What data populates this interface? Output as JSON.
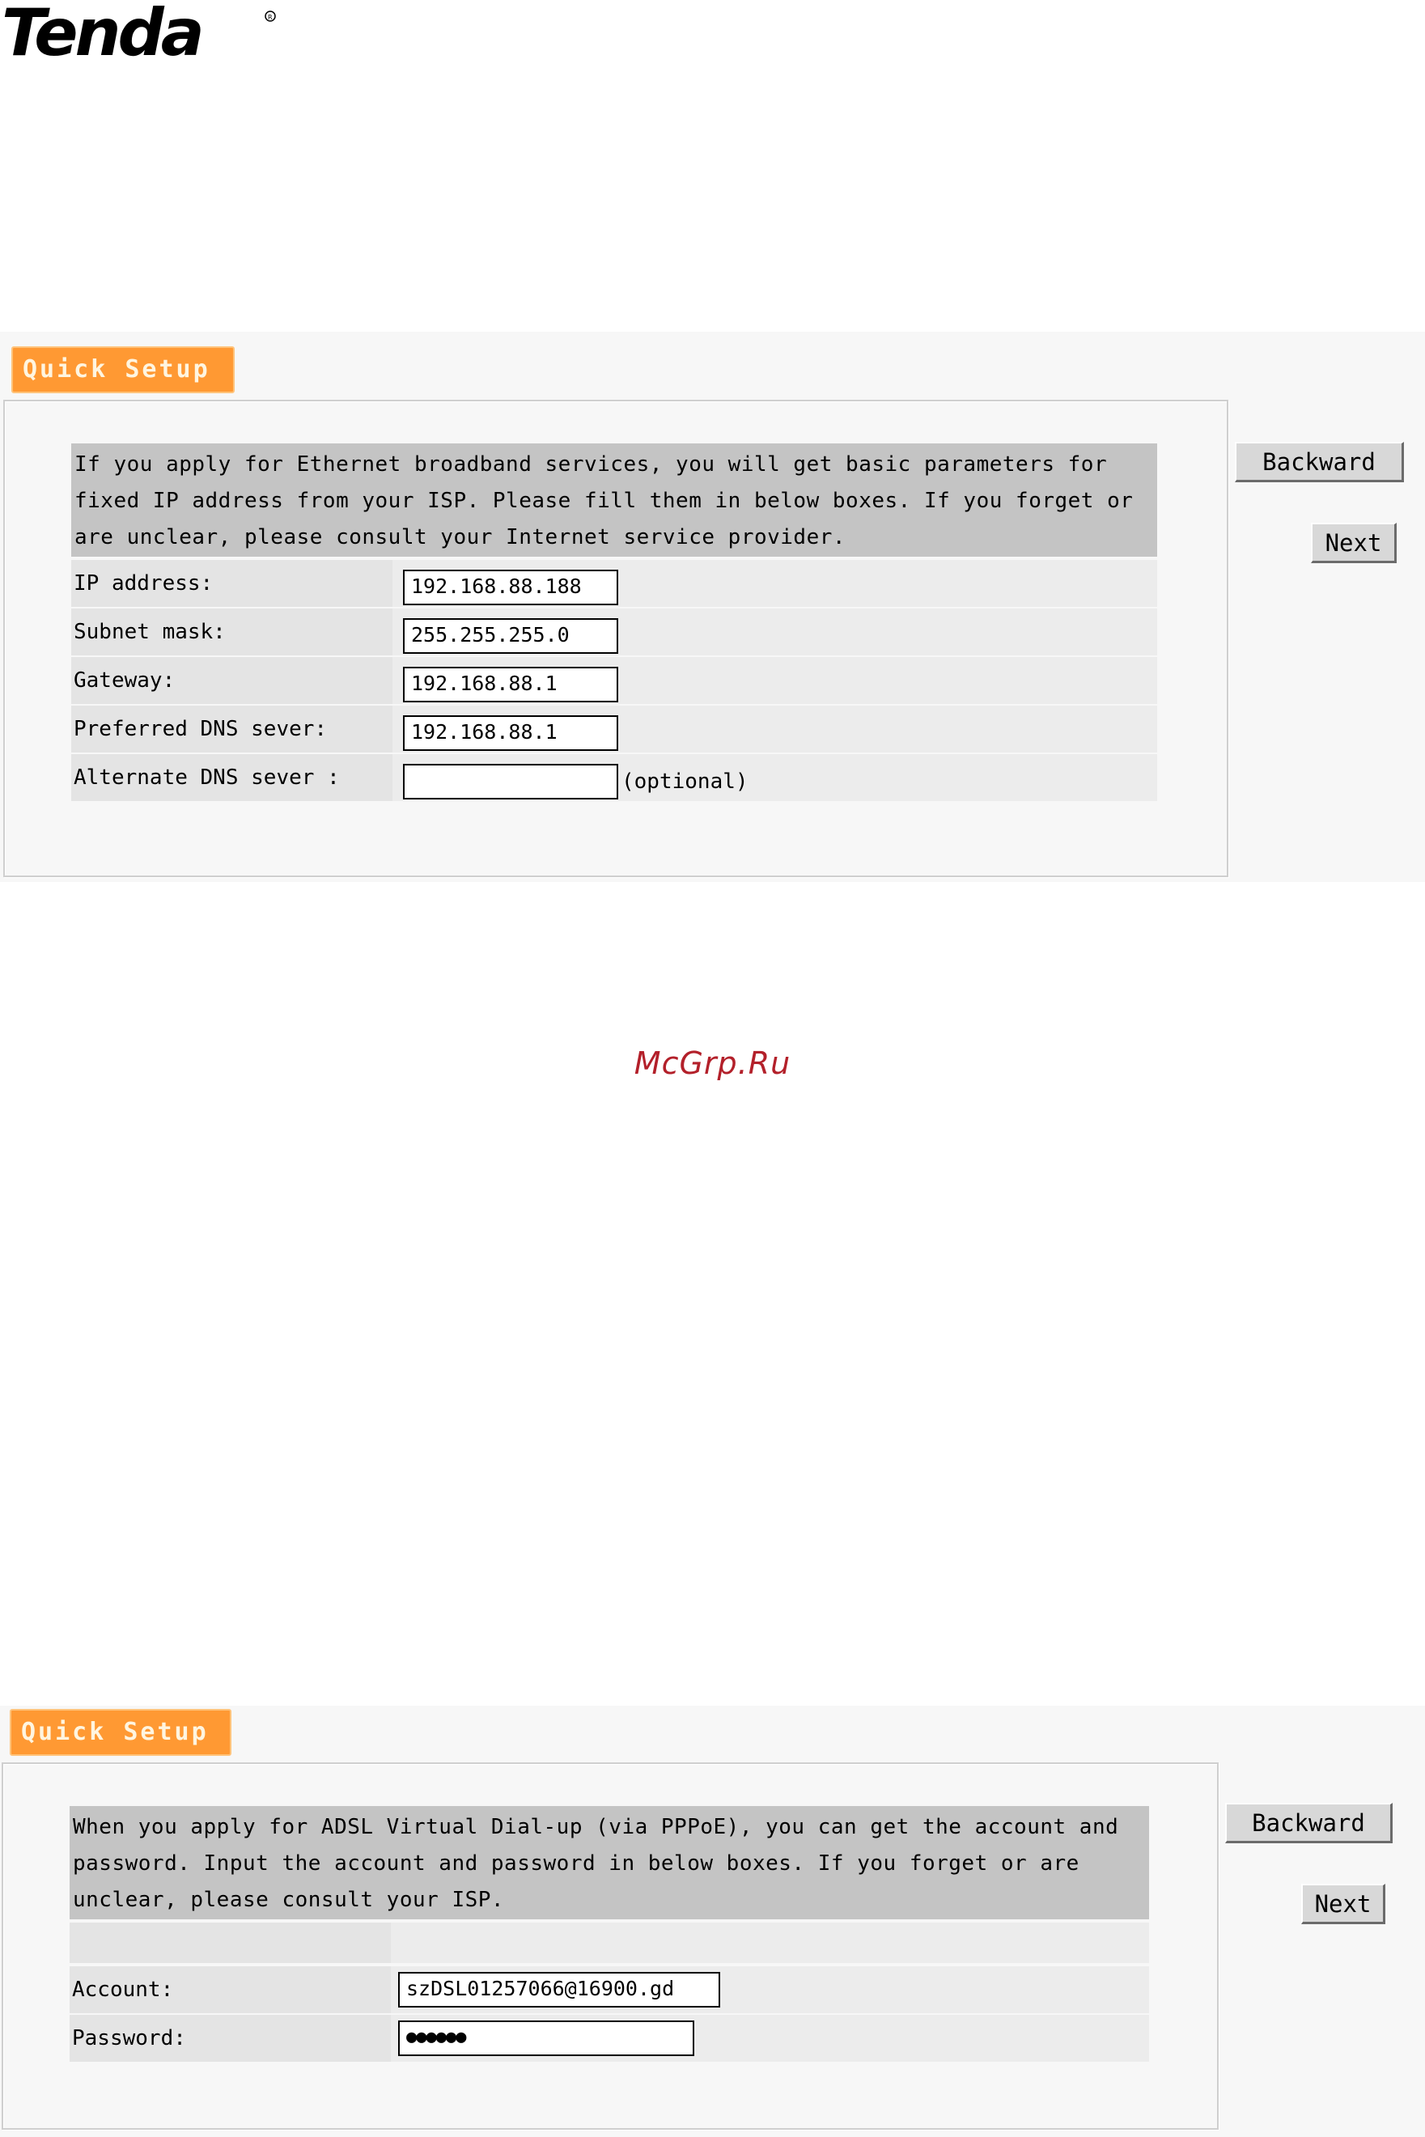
{
  "brand": {
    "logo_text": "Tenda"
  },
  "colors": {
    "accent_tab": "#ff9933",
    "description_bg": "#c4c4c4",
    "watermark": "#b3202a"
  },
  "watermark": "McGrp.Ru",
  "static_ip_panel": {
    "tab_label": "Quick Setup",
    "description": "If you apply for Ethernet broadband services, you will get basic parameters for fixed IP address from your ISP. Please fill them in below boxes. If you forget or are unclear, please consult your Internet service provider.",
    "fields": [
      {
        "label": "IP address:",
        "value": "192.168.88.188"
      },
      {
        "label": "Subnet mask:",
        "value": "255.255.255.0"
      },
      {
        "label": "Gateway:",
        "value": "192.168.88.1"
      },
      {
        "label": "Preferred DNS sever:",
        "value": "192.168.88.1"
      },
      {
        "label": "Alternate DNS sever :",
        "value": "",
        "hint": "(optional)"
      }
    ],
    "backward_label": "Backward",
    "next_label": "Next"
  },
  "pppoe_panel": {
    "tab_label": "Quick Setup",
    "description": "When you apply for ADSL Virtual Dial-up (via PPPoE), you can get the account and password. Input the account and password in below boxes. If you forget or are unclear, please consult your ISP.",
    "fields": [
      {
        "label": "Account:",
        "value": "szDSL01257066@16900.gd"
      },
      {
        "label": "Password:",
        "value": "●●●●●●"
      }
    ],
    "backward_label": "Backward",
    "next_label": "Next"
  }
}
